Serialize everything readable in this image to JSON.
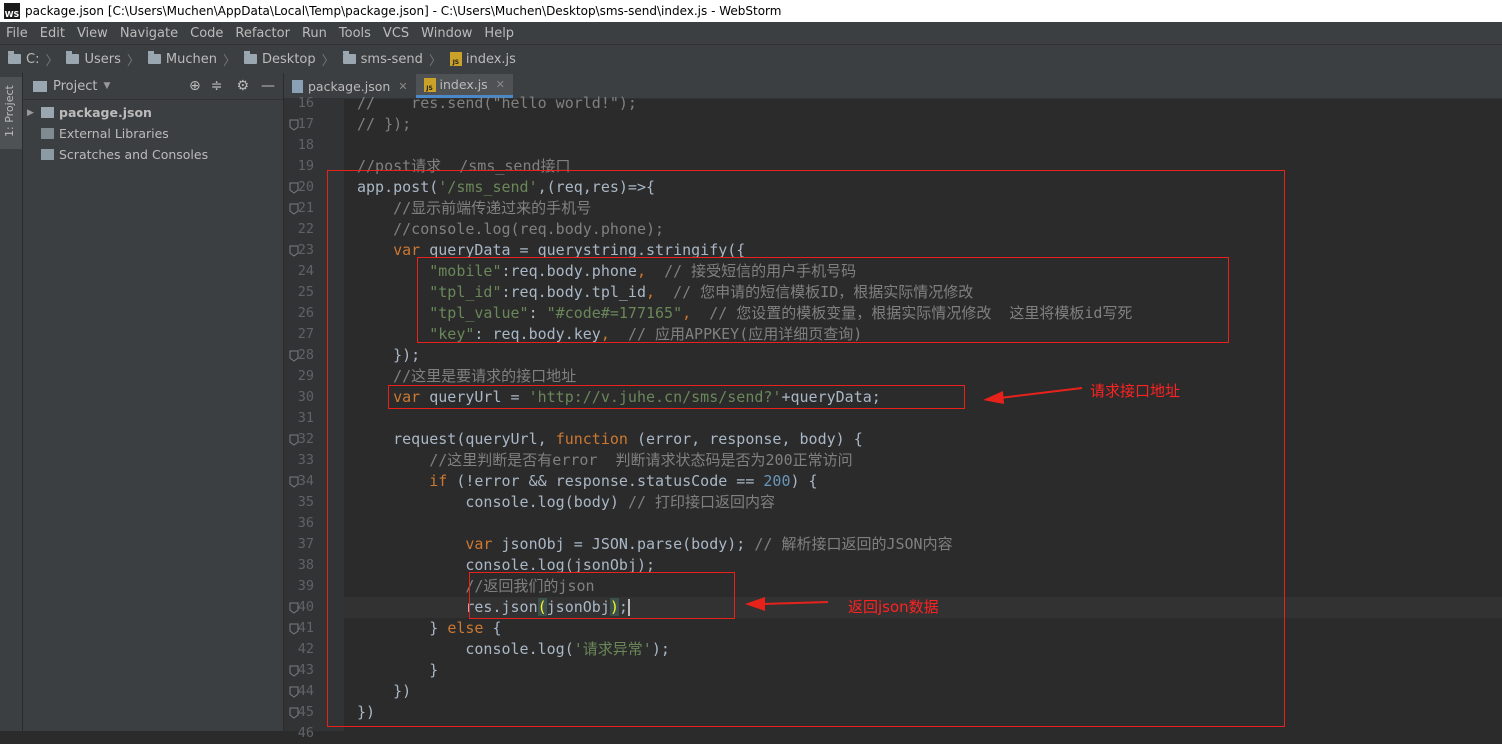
{
  "window": {
    "title": "package.json [C:\\Users\\Muchen\\AppData\\Local\\Temp\\package.json] - C:\\Users\\Muchen\\Desktop\\sms-send\\index.js - WebStorm",
    "app_badge": "WS"
  },
  "menu": [
    "File",
    "Edit",
    "View",
    "Navigate",
    "Code",
    "Refactor",
    "Run",
    "Tools",
    "VCS",
    "Window",
    "Help"
  ],
  "breadcrumb": [
    "C:",
    "Users",
    "Muchen",
    "Desktop",
    "sms-send",
    "index.js"
  ],
  "side_tab": "1: Project",
  "project_panel": {
    "title": "Project",
    "items": [
      {
        "label": "package.json",
        "bold": true
      },
      {
        "label": "External Libraries",
        "bold": false
      },
      {
        "label": "Scratches and Consoles",
        "bold": false
      }
    ]
  },
  "tabs": [
    {
      "label": "package.json",
      "active": false
    },
    {
      "label": "index.js",
      "active": true
    }
  ],
  "code_lines": [
    {
      "n": 16,
      "tokens": [
        [
          "cm",
          "//    res.send(\"hello world!\");"
        ]
      ]
    },
    {
      "n": 17,
      "tokens": [
        [
          "cm",
          "// });"
        ]
      ]
    },
    {
      "n": 18,
      "tokens": []
    },
    {
      "n": 19,
      "tokens": [
        [
          "cm",
          "//post请求  /sms_send接口"
        ]
      ]
    },
    {
      "n": 20,
      "tokens": [
        [
          "",
          "app.post("
        ],
        [
          "str",
          "'/sms_send'"
        ],
        [
          "",
          ",(req,res)=>{"
        ]
      ]
    },
    {
      "n": 21,
      "tokens": [
        [
          "",
          "    "
        ],
        [
          "cm",
          "//显示前端传递过来的手机号"
        ]
      ]
    },
    {
      "n": 22,
      "tokens": [
        [
          "",
          "    "
        ],
        [
          "cm",
          "//console.log(req.body.phone);"
        ]
      ]
    },
    {
      "n": 23,
      "tokens": [
        [
          "",
          "    "
        ],
        [
          "kw",
          "var "
        ],
        [
          "",
          "queryData = querystring.stringify({"
        ]
      ]
    },
    {
      "n": 24,
      "tokens": [
        [
          "",
          "        "
        ],
        [
          "str",
          "\"mobile\""
        ],
        [
          "",
          ":req.body.phone"
        ],
        [
          "kw",
          ","
        ],
        [
          "",
          "  "
        ],
        [
          "cm",
          "// 接受短信的用户手机号码"
        ]
      ]
    },
    {
      "n": 25,
      "tokens": [
        [
          "",
          "        "
        ],
        [
          "str",
          "\"tpl_id\""
        ],
        [
          "",
          ":req.body.tpl_id"
        ],
        [
          "kw",
          ","
        ],
        [
          "",
          "  "
        ],
        [
          "cm",
          "// 您申请的短信模板ID，根据实际情况修改"
        ]
      ]
    },
    {
      "n": 26,
      "tokens": [
        [
          "",
          "        "
        ],
        [
          "str",
          "\"tpl_value\""
        ],
        [
          "",
          ": "
        ],
        [
          "str",
          "\"#code#=177165\""
        ],
        [
          "kw",
          ","
        ],
        [
          "",
          "  "
        ],
        [
          "cm",
          "// 您设置的模板变量，根据实际情况修改  这里将模板id写死"
        ]
      ]
    },
    {
      "n": 27,
      "tokens": [
        [
          "",
          "        "
        ],
        [
          "str",
          "\"key\""
        ],
        [
          "",
          ": req.body.key"
        ],
        [
          "kw",
          ","
        ],
        [
          "",
          "  "
        ],
        [
          "cm",
          "// 应用APPKEY(应用详细页查询)"
        ]
      ]
    },
    {
      "n": 28,
      "tokens": [
        [
          "",
          "    });"
        ]
      ]
    },
    {
      "n": 29,
      "tokens": [
        [
          "",
          "    "
        ],
        [
          "cm",
          "//这里是要请求的接口地址"
        ]
      ]
    },
    {
      "n": 30,
      "tokens": [
        [
          "",
          "    "
        ],
        [
          "kw",
          "var "
        ],
        [
          "",
          "queryUrl = "
        ],
        [
          "str",
          "'http://v.juhe.cn/sms/send?'"
        ],
        [
          "",
          "+queryData;"
        ]
      ]
    },
    {
      "n": 31,
      "tokens": []
    },
    {
      "n": 32,
      "tokens": [
        [
          "",
          "    request(queryUrl, "
        ],
        [
          "kw",
          "function "
        ],
        [
          "",
          "(error, response, body) {"
        ]
      ]
    },
    {
      "n": 33,
      "tokens": [
        [
          "",
          "        "
        ],
        [
          "cm",
          "//这里判断是否有error  判断请求状态码是否为200正常访问"
        ]
      ]
    },
    {
      "n": 34,
      "tokens": [
        [
          "",
          "        "
        ],
        [
          "kw",
          "if "
        ],
        [
          "",
          "(!error && response.statusCode == "
        ],
        [
          "num",
          "200"
        ],
        [
          "",
          ") {"
        ]
      ]
    },
    {
      "n": 35,
      "tokens": [
        [
          "",
          "            console.log(body) "
        ],
        [
          "cm",
          "// 打印接口返回内容"
        ]
      ]
    },
    {
      "n": 36,
      "tokens": []
    },
    {
      "n": 37,
      "tokens": [
        [
          "",
          "            "
        ],
        [
          "kw",
          "var "
        ],
        [
          "",
          "jsonObj = JSON.parse(body); "
        ],
        [
          "cm",
          "// 解析接口返回的JSON内容"
        ]
      ]
    },
    {
      "n": 38,
      "tokens": [
        [
          "",
          "            console.log(jsonObj);"
        ]
      ]
    },
    {
      "n": 39,
      "tokens": [
        [
          "",
          "            "
        ],
        [
          "cm",
          "//返回我们的json"
        ]
      ]
    },
    {
      "n": 40,
      "tokens": [
        [
          "",
          "            res.json"
        ],
        [
          "brk",
          "("
        ],
        [
          "",
          "jsonObj"
        ],
        [
          "brk",
          ")"
        ],
        [
          "",
          ";"
        ]
      ],
      "current": true
    },
    {
      "n": 41,
      "tokens": [
        [
          "",
          "        } "
        ],
        [
          "kw",
          "else "
        ],
        [
          "",
          "{"
        ]
      ]
    },
    {
      "n": 42,
      "tokens": [
        [
          "",
          "            console.log("
        ],
        [
          "str",
          "'请求异常'"
        ],
        [
          "",
          ");"
        ]
      ]
    },
    {
      "n": 43,
      "tokens": [
        [
          "",
          "        }"
        ]
      ]
    },
    {
      "n": 44,
      "tokens": [
        [
          "",
          "    })"
        ]
      ]
    },
    {
      "n": 45,
      "tokens": [
        [
          "",
          "})"
        ]
      ]
    },
    {
      "n": 46,
      "tokens": []
    }
  ],
  "annotations": [
    {
      "label": "请求接口地址"
    },
    {
      "label": "返回json数据"
    }
  ],
  "colors": {
    "annotation": "#ff2222",
    "keyword": "#cc7832",
    "string": "#6a8759",
    "comment": "#808080",
    "number": "#6897bb"
  }
}
